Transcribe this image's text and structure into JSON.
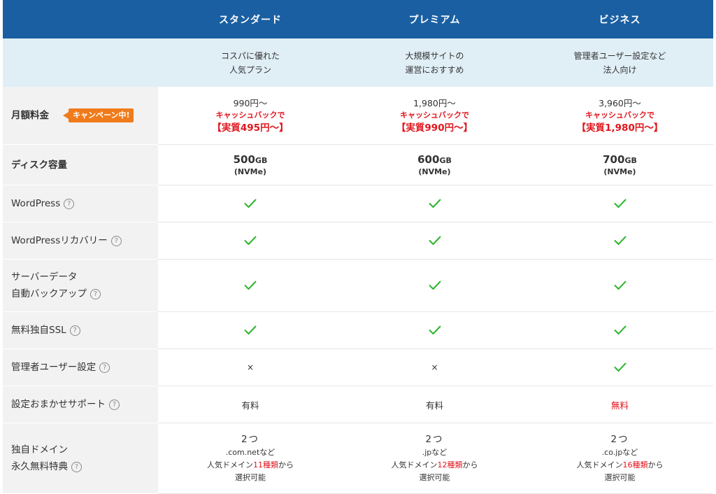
{
  "plans": [
    {
      "name": "スタンダード",
      "desc_line1": "コスパに優れた",
      "desc_line2": "人気プラン",
      "price": "990円〜",
      "cashback": "キャッシュバックで",
      "real_price": "【実質495円〜】",
      "disk_size": "500",
      "disk_unit": "GB",
      "disk_type": "(NVMe)",
      "wordpress": "check",
      "wp_recovery": "check",
      "backup": "check",
      "ssl": "check",
      "admin_user": "cross",
      "admin_user_text": "×",
      "support": "有料",
      "support_highlight": false,
      "domain_count": "2つ",
      "domain_tlds": ".com.netなど",
      "domain_prefix": "人気ドメイン",
      "domain_kinds": "11種類",
      "domain_suffix": "から",
      "domain_select": "選択可能"
    },
    {
      "name": "プレミアム",
      "desc_line1": "大規模サイトの",
      "desc_line2": "運営におすすめ",
      "price": "1,980円〜",
      "cashback": "キャッシュバックで",
      "real_price": "【実質990円〜】",
      "disk_size": "600",
      "disk_unit": "GB",
      "disk_type": "(NVMe)",
      "wordpress": "check",
      "wp_recovery": "check",
      "backup": "check",
      "ssl": "check",
      "admin_user": "cross",
      "admin_user_text": "×",
      "support": "有料",
      "support_highlight": false,
      "domain_count": "2つ",
      "domain_tlds": ".jpなど",
      "domain_prefix": "人気ドメイン",
      "domain_kinds": "12種類",
      "domain_suffix": "から",
      "domain_select": "選択可能"
    },
    {
      "name": "ビジネス",
      "desc_line1": "管理者ユーザー設定など",
      "desc_line2": "法人向け",
      "price": "3,960円〜",
      "cashback": "キャッシュバックで",
      "real_price": "【実質1,980円〜】",
      "disk_size": "700",
      "disk_unit": "GB",
      "disk_type": "(NVMe)",
      "wordpress": "check",
      "wp_recovery": "check",
      "backup": "check",
      "ssl": "check",
      "admin_user": "check",
      "admin_user_text": "",
      "support": "無料",
      "support_highlight": true,
      "domain_count": "2つ",
      "domain_tlds": ".co.jpなど",
      "domain_prefix": "人気ドメイン",
      "domain_kinds": "16種類",
      "domain_suffix": "から",
      "domain_select": "選択可能"
    }
  ],
  "rows": {
    "price": {
      "label": "月額料金",
      "badge": "キャンペーン中!"
    },
    "disk": {
      "label": "ディスク容量"
    },
    "wordpress": {
      "label": "WordPress"
    },
    "wp_recovery": {
      "label": "WordPressリカバリー"
    },
    "backup": {
      "label_line1": "サーバーデータ",
      "label_line2": "自動バックアップ"
    },
    "ssl": {
      "label": "無料独自SSL"
    },
    "admin_user": {
      "label": "管理者ユーザー設定"
    },
    "support": {
      "label": "設定おまかせサポート"
    },
    "domain": {
      "label_line1": "独自ドメイン",
      "label_line2": "永久無料特典"
    }
  },
  "help_icon_glyph": "?",
  "colors": {
    "header_bg": "#1a5fa2",
    "subheader_bg": "#e0eef6",
    "label_bg": "#f2f2f2",
    "accent_red": "#e0161d",
    "badge_orange": "#f07b1a",
    "check_green": "#2db52d"
  }
}
